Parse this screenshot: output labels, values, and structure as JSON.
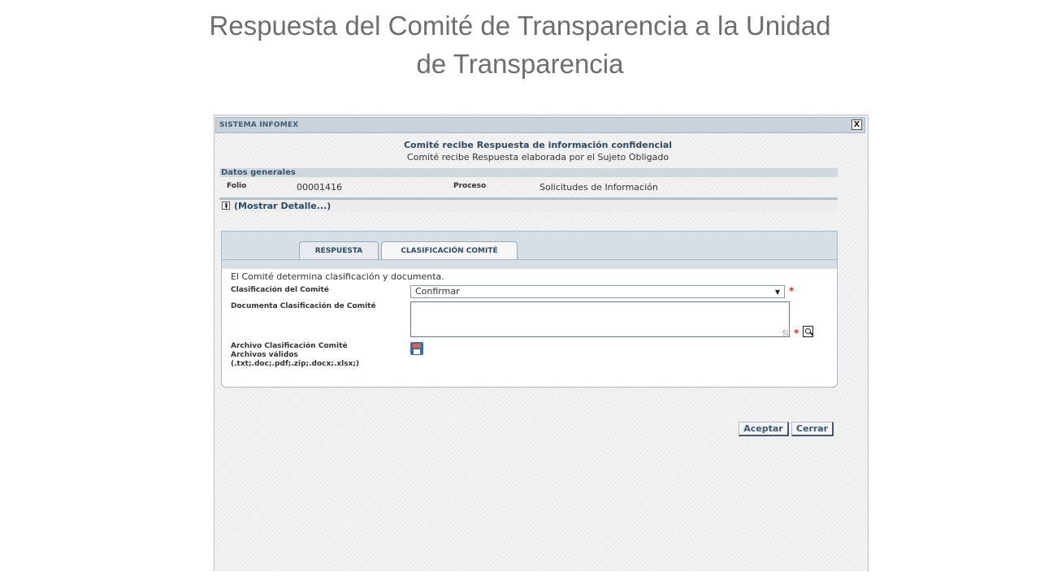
{
  "slide": {
    "title_line1": "Respuesta del Comité de Transparencia a la Unidad",
    "title_line2": "de Transparencia"
  },
  "window": {
    "title": "SISTEMA INFOMEX",
    "close_label": "X",
    "heading": "Comité recibe Respuesta de información confidencial",
    "subheading": "Comité recibe Respuesta elaborada por el Sujeto Obligado"
  },
  "general": {
    "section_label": "Datos generales",
    "folio_label": "Folio",
    "folio_value": "00001416",
    "proceso_label": "Proceso",
    "proceso_value": "Solicitudes de Información",
    "details_toggle": "(Mostrar Detalle...)"
  },
  "tabs": [
    {
      "label": "RESPUESTA",
      "active": true
    },
    {
      "label": "CLASIFICACIÓN COMITÉ",
      "active": false
    }
  ],
  "form": {
    "intro": "El Comité determina clasificación y documenta.",
    "clasificacion_label": "Clasificación del Comité",
    "clasificacion_value": "Confirmar",
    "documenta_label": "Documenta Clasificación de Comité",
    "documenta_value": "",
    "archivo_label": "Archivo Clasificación Comité",
    "archivo_valid_label": "Archivos válidos",
    "archivo_types": "(.txt;.doc;.pdf;.zip;.docx;.xlsx;)",
    "required_mark": "*"
  },
  "buttons": {
    "accept": "Aceptar",
    "close": "Cerrar"
  },
  "colors": {
    "title_text": "#6e6e6e",
    "header_bar": "#c9d3dc",
    "accent_text": "#2f4a62",
    "required": "#d0281f"
  },
  "icons": {
    "close": "close-icon",
    "expand": "chevron-double-down-icon",
    "search": "search-document-icon",
    "save": "floppy-disk-icon"
  }
}
